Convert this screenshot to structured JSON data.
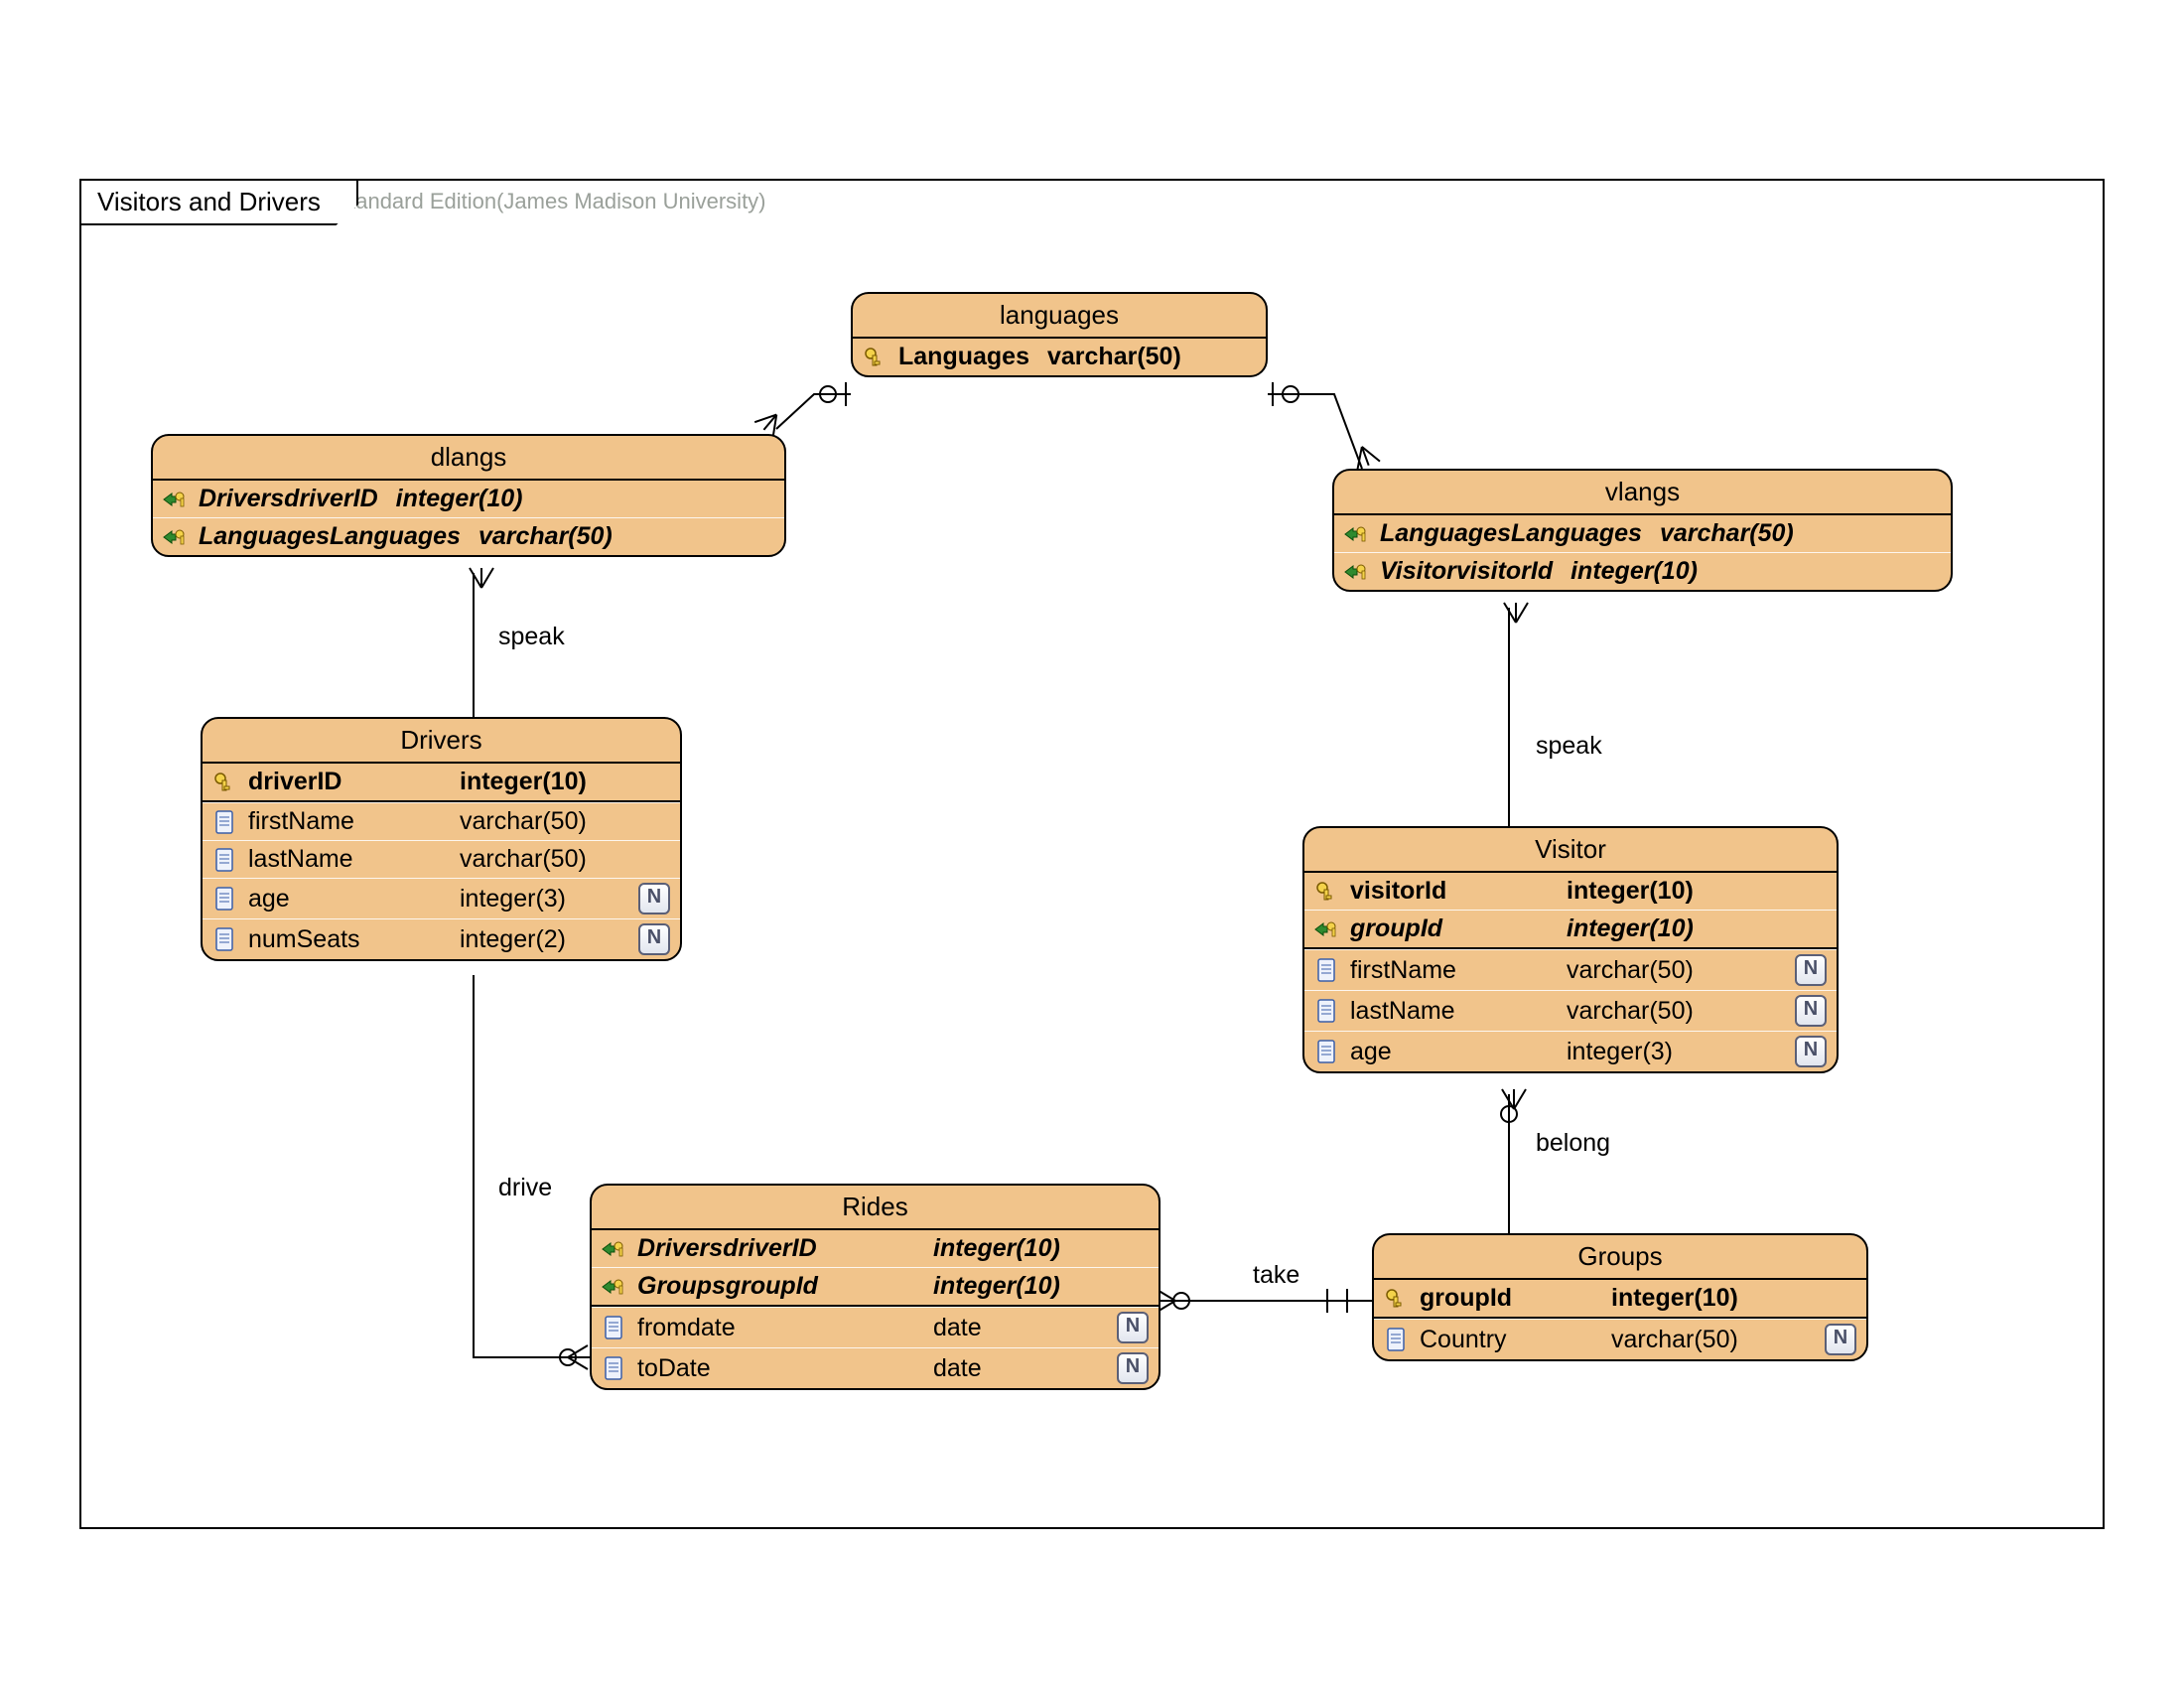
{
  "frame": {
    "title": "Visitors and Drivers",
    "watermark": "Visual Paradigm for UML Standard Edition(James Madison University)"
  },
  "entities": {
    "languages": {
      "title": "languages",
      "cols": [
        {
          "icon": "pk",
          "name": "Languages",
          "type": "varchar(50)",
          "bold": true
        }
      ]
    },
    "dlangs": {
      "title": "dlangs",
      "cols": [
        {
          "icon": "fk",
          "name": "DriversdriverID",
          "type": "integer(10)",
          "fk": true
        },
        {
          "icon": "fk",
          "name": "LanguagesLanguages",
          "type": "varchar(50)",
          "fk": true
        }
      ]
    },
    "vlangs": {
      "title": "vlangs",
      "cols": [
        {
          "icon": "fk",
          "name": "LanguagesLanguages",
          "type": "varchar(50)",
          "fk": true
        },
        {
          "icon": "fk",
          "name": "VisitorvisitorId",
          "type": "integer(10)",
          "fk": true
        }
      ]
    },
    "drivers": {
      "title": "Drivers",
      "cols": [
        {
          "icon": "pk",
          "name": "driverID",
          "type": "integer(10)",
          "bold": true
        },
        {
          "icon": "col",
          "name": "firstName",
          "type": "varchar(50)"
        },
        {
          "icon": "col",
          "name": "lastName",
          "type": "varchar(50)"
        },
        {
          "icon": "col",
          "name": "age",
          "type": "integer(3)",
          "null": true
        },
        {
          "icon": "col",
          "name": "numSeats",
          "type": "integer(2)",
          "null": true
        }
      ]
    },
    "visitor": {
      "title": "Visitor",
      "cols": [
        {
          "icon": "pk",
          "name": "visitorId",
          "type": "integer(10)",
          "bold": true
        },
        {
          "icon": "fk",
          "name": "groupId",
          "type": "integer(10)",
          "fk": true
        },
        {
          "icon": "col",
          "name": "firstName",
          "type": "varchar(50)",
          "null": true
        },
        {
          "icon": "col",
          "name": "lastName",
          "type": "varchar(50)",
          "null": true
        },
        {
          "icon": "col",
          "name": "age",
          "type": "integer(3)",
          "null": true
        }
      ]
    },
    "rides": {
      "title": "Rides",
      "cols": [
        {
          "icon": "fk",
          "name": "DriversdriverID",
          "type": "integer(10)",
          "fk": true
        },
        {
          "icon": "fk",
          "name": "GroupsgroupId",
          "type": "integer(10)",
          "fk": true
        },
        {
          "icon": "col",
          "name": "fromdate",
          "type": "date",
          "null": true
        },
        {
          "icon": "col",
          "name": "toDate",
          "type": "date",
          "null": true
        }
      ]
    },
    "groups": {
      "title": "Groups",
      "cols": [
        {
          "icon": "pk",
          "name": "groupId",
          "type": "integer(10)",
          "bold": true
        },
        {
          "icon": "col",
          "name": "Country",
          "type": "varchar(50)",
          "null": true
        }
      ]
    }
  },
  "relations": {
    "speak1": "speak",
    "speak2": "speak",
    "drive": "drive",
    "take": "take",
    "belong": "belong"
  },
  "nullable_glyph": "N"
}
